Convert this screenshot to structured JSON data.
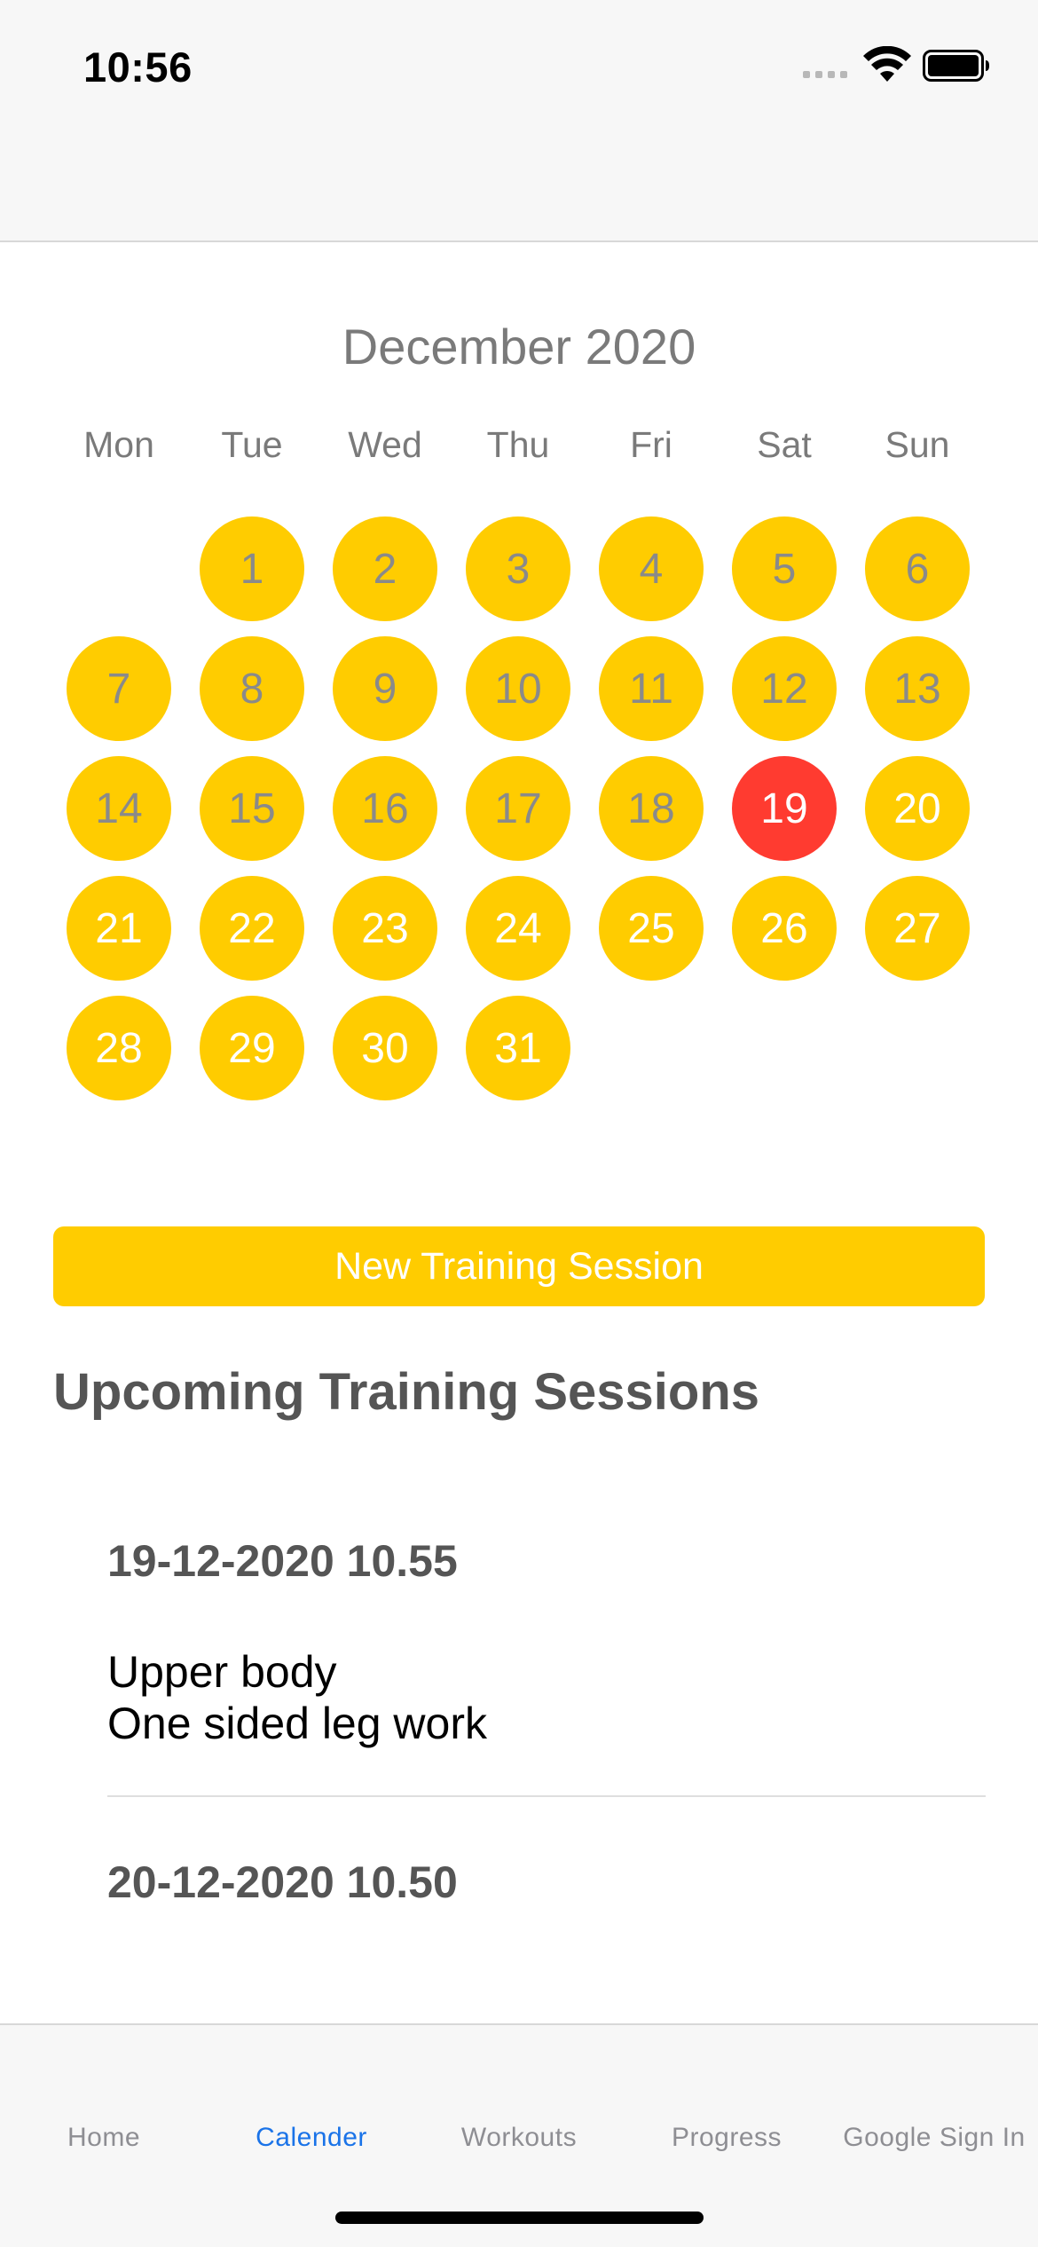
{
  "status_bar": {
    "time": "10:56"
  },
  "calendar": {
    "month_title": "December 2020",
    "weekdays": [
      "Mon",
      "Tue",
      "Wed",
      "Thu",
      "Fri",
      "Sat",
      "Sun"
    ],
    "first_weekday_offset": 1,
    "days_in_month": 31,
    "today": 19,
    "colors": {
      "day": "#ffcc00",
      "today": "#ff3b30",
      "past_text": "#8a8a8a",
      "future_text": "#ffffff"
    }
  },
  "new_session_button": {
    "label": "New Training Session"
  },
  "upcoming": {
    "title": "Upcoming Training Sessions",
    "sessions": [
      {
        "date": "19-12-2020 10.55",
        "workouts": [
          "Upper body",
          "One sided leg work"
        ]
      },
      {
        "date": "20-12-2020 10.50",
        "workouts": []
      }
    ]
  },
  "tab_bar": {
    "tabs": [
      {
        "label": "Home",
        "active": false
      },
      {
        "label": "Calender",
        "active": true
      },
      {
        "label": "Workouts",
        "active": false
      },
      {
        "label": "Progress",
        "active": false
      },
      {
        "label": "Google Sign In",
        "active": false
      }
    ],
    "active_color": "#1a73e8"
  }
}
